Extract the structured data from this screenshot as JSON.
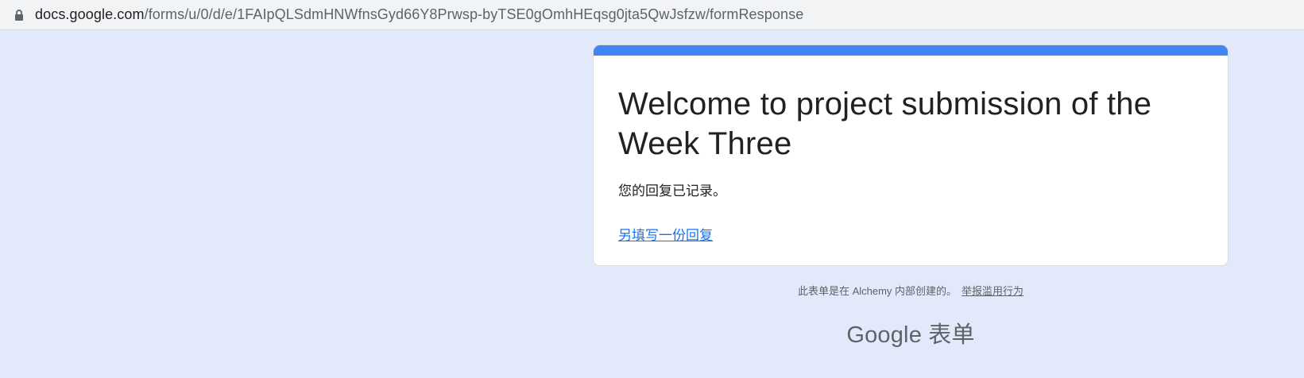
{
  "browser": {
    "url_host": "docs.google.com",
    "url_path": "/forms/u/0/d/e/1FAIpQLSdmHNWfnsGyd66Y8Prwsp-byTSE0gOmhHEqsg0jta5QwJsfzw/formResponse",
    "lock_icon": "lock-icon"
  },
  "form": {
    "title": "Welcome to project submission of the Week Three",
    "confirmation": "您的回复已记录。",
    "resubmit_link": "另填写一份回复"
  },
  "footer": {
    "note": "此表单是在 Alchemy 内部创建的。",
    "report_link": "举报滥用行为",
    "brand": "Google 表单"
  },
  "colors": {
    "background": "#e1e9fb",
    "accent": "#4285f4",
    "link": "#1a73e8"
  }
}
